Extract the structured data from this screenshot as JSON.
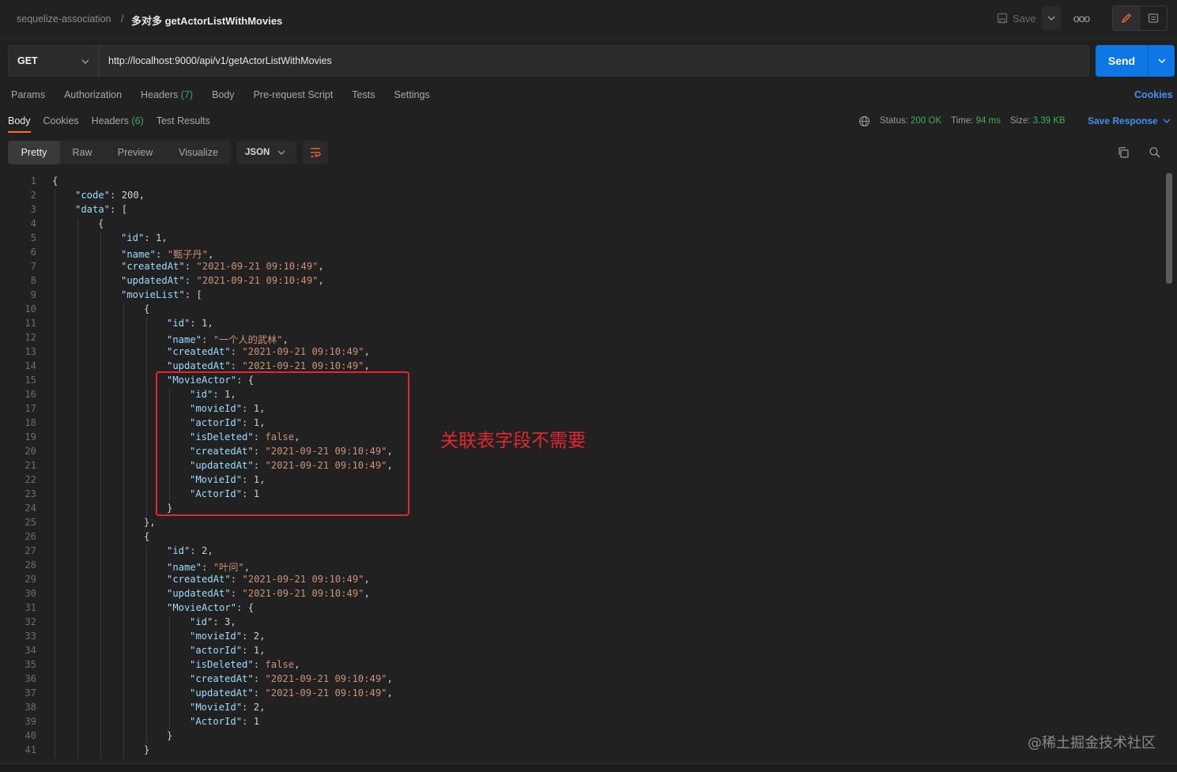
{
  "breadcrumb": {
    "parent": "sequelize-association",
    "separator": "/",
    "current": "多对多 getActorListWithMovies"
  },
  "toolbar": {
    "save_label": "Save",
    "more": "ooo"
  },
  "request": {
    "method": "GET",
    "url": "http://localhost:9000/api/v1/getActorListWithMovies",
    "send_label": "Send"
  },
  "request_tabs": {
    "params": "Params",
    "authorization": "Authorization",
    "headers": "Headers",
    "headers_count": "(7)",
    "body": "Body",
    "prerequest": "Pre-request Script",
    "tests": "Tests",
    "settings": "Settings",
    "cookies": "Cookies"
  },
  "response_tabs": {
    "body": "Body",
    "cookies": "Cookies",
    "headers": "Headers",
    "headers_count": "(6)",
    "test_results": "Test Results"
  },
  "response_meta": {
    "status_label": "Status:",
    "status_value": "200 OK",
    "time_label": "Time:",
    "time_value": "94 ms",
    "size_label": "Size:",
    "size_value": "3.39 KB",
    "save_response": "Save Response"
  },
  "view_tabs": {
    "pretty": "Pretty",
    "raw": "Raw",
    "preview": "Preview",
    "visualize": "Visualize",
    "format": "JSON"
  },
  "code_lines": [
    {
      "n": "1",
      "i": 0,
      "t": [
        [
          "b",
          "{"
        ]
      ]
    },
    {
      "n": "2",
      "i": 1,
      "t": [
        [
          "k",
          "\"code\""
        ],
        [
          "b",
          ": "
        ],
        [
          "n",
          "200"
        ],
        [
          "b",
          ","
        ]
      ]
    },
    {
      "n": "3",
      "i": 1,
      "t": [
        [
          "k",
          "\"data\""
        ],
        [
          "b",
          ": ["
        ]
      ]
    },
    {
      "n": "4",
      "i": 2,
      "t": [
        [
          "b",
          "{"
        ]
      ]
    },
    {
      "n": "5",
      "i": 3,
      "t": [
        [
          "k",
          "\"id\""
        ],
        [
          "b",
          ": "
        ],
        [
          "n",
          "1"
        ],
        [
          "b",
          ","
        ]
      ]
    },
    {
      "n": "6",
      "i": 3,
      "t": [
        [
          "k",
          "\"name\""
        ],
        [
          "b",
          ": "
        ],
        [
          "s",
          "\"甄子丹\""
        ],
        [
          "b",
          ","
        ]
      ]
    },
    {
      "n": "7",
      "i": 3,
      "t": [
        [
          "k",
          "\"createdAt\""
        ],
        [
          "b",
          ": "
        ],
        [
          "s",
          "\"2021-09-21 09:10:49\""
        ],
        [
          "b",
          ","
        ]
      ]
    },
    {
      "n": "8",
      "i": 3,
      "t": [
        [
          "k",
          "\"updatedAt\""
        ],
        [
          "b",
          ": "
        ],
        [
          "s",
          "\"2021-09-21 09:10:49\""
        ],
        [
          "b",
          ","
        ]
      ]
    },
    {
      "n": "9",
      "i": 3,
      "t": [
        [
          "k",
          "\"movieList\""
        ],
        [
          "b",
          ": ["
        ]
      ]
    },
    {
      "n": "10",
      "i": 4,
      "t": [
        [
          "b",
          "{"
        ]
      ]
    },
    {
      "n": "11",
      "i": 5,
      "t": [
        [
          "k",
          "\"id\""
        ],
        [
          "b",
          ": "
        ],
        [
          "n",
          "1"
        ],
        [
          "b",
          ","
        ]
      ]
    },
    {
      "n": "12",
      "i": 5,
      "t": [
        [
          "k",
          "\"name\""
        ],
        [
          "b",
          ": "
        ],
        [
          "s",
          "\"一个人的武林\""
        ],
        [
          "b",
          ","
        ]
      ]
    },
    {
      "n": "13",
      "i": 5,
      "t": [
        [
          "k",
          "\"createdAt\""
        ],
        [
          "b",
          ": "
        ],
        [
          "s",
          "\"2021-09-21 09:10:49\""
        ],
        [
          "b",
          ","
        ]
      ]
    },
    {
      "n": "14",
      "i": 5,
      "t": [
        [
          "k",
          "\"updatedAt\""
        ],
        [
          "b",
          ": "
        ],
        [
          "s",
          "\"2021-09-21 09:10:49\""
        ],
        [
          "b",
          ","
        ]
      ]
    },
    {
      "n": "15",
      "i": 5,
      "t": [
        [
          "k",
          "\"MovieActor\""
        ],
        [
          "b",
          ": {"
        ]
      ]
    },
    {
      "n": "16",
      "i": 6,
      "t": [
        [
          "k",
          "\"id\""
        ],
        [
          "b",
          ": "
        ],
        [
          "n",
          "1"
        ],
        [
          "b",
          ","
        ]
      ]
    },
    {
      "n": "17",
      "i": 6,
      "t": [
        [
          "k",
          "\"movieId\""
        ],
        [
          "b",
          ": "
        ],
        [
          "n",
          "1"
        ],
        [
          "b",
          ","
        ]
      ]
    },
    {
      "n": "18",
      "i": 6,
      "t": [
        [
          "k",
          "\"actorId\""
        ],
        [
          "b",
          ": "
        ],
        [
          "n",
          "1"
        ],
        [
          "b",
          ","
        ]
      ]
    },
    {
      "n": "19",
      "i": 6,
      "t": [
        [
          "k",
          "\"isDeleted\""
        ],
        [
          "b",
          ": "
        ],
        [
          "s",
          "false"
        ],
        [
          "b",
          ","
        ]
      ]
    },
    {
      "n": "20",
      "i": 6,
      "t": [
        [
          "k",
          "\"createdAt\""
        ],
        [
          "b",
          ": "
        ],
        [
          "s",
          "\"2021-09-21 09:10:49\""
        ],
        [
          "b",
          ","
        ]
      ]
    },
    {
      "n": "21",
      "i": 6,
      "t": [
        [
          "k",
          "\"updatedAt\""
        ],
        [
          "b",
          ": "
        ],
        [
          "s",
          "\"2021-09-21 09:10:49\""
        ],
        [
          "b",
          ","
        ]
      ]
    },
    {
      "n": "22",
      "i": 6,
      "t": [
        [
          "k",
          "\"MovieId\""
        ],
        [
          "b",
          ": "
        ],
        [
          "n",
          "1"
        ],
        [
          "b",
          ","
        ]
      ]
    },
    {
      "n": "23",
      "i": 6,
      "t": [
        [
          "k",
          "\"ActorId\""
        ],
        [
          "b",
          ": "
        ],
        [
          "n",
          "1"
        ]
      ]
    },
    {
      "n": "24",
      "i": 5,
      "t": [
        [
          "b",
          "}"
        ]
      ]
    },
    {
      "n": "25",
      "i": 4,
      "t": [
        [
          "b",
          "},"
        ]
      ]
    },
    {
      "n": "26",
      "i": 4,
      "t": [
        [
          "b",
          "{"
        ]
      ]
    },
    {
      "n": "27",
      "i": 5,
      "t": [
        [
          "k",
          "\"id\""
        ],
        [
          "b",
          ": "
        ],
        [
          "n",
          "2"
        ],
        [
          "b",
          ","
        ]
      ]
    },
    {
      "n": "28",
      "i": 5,
      "t": [
        [
          "k",
          "\"name\""
        ],
        [
          "b",
          ": "
        ],
        [
          "s",
          "\"叶问\""
        ],
        [
          "b",
          ","
        ]
      ]
    },
    {
      "n": "29",
      "i": 5,
      "t": [
        [
          "k",
          "\"createdAt\""
        ],
        [
          "b",
          ": "
        ],
        [
          "s",
          "\"2021-09-21 09:10:49\""
        ],
        [
          "b",
          ","
        ]
      ]
    },
    {
      "n": "30",
      "i": 5,
      "t": [
        [
          "k",
          "\"updatedAt\""
        ],
        [
          "b",
          ": "
        ],
        [
          "s",
          "\"2021-09-21 09:10:49\""
        ],
        [
          "b",
          ","
        ]
      ]
    },
    {
      "n": "31",
      "i": 5,
      "t": [
        [
          "k",
          "\"MovieActor\""
        ],
        [
          "b",
          ": {"
        ]
      ]
    },
    {
      "n": "32",
      "i": 6,
      "t": [
        [
          "k",
          "\"id\""
        ],
        [
          "b",
          ": "
        ],
        [
          "n",
          "3"
        ],
        [
          "b",
          ","
        ]
      ]
    },
    {
      "n": "33",
      "i": 6,
      "t": [
        [
          "k",
          "\"movieId\""
        ],
        [
          "b",
          ": "
        ],
        [
          "n",
          "2"
        ],
        [
          "b",
          ","
        ]
      ]
    },
    {
      "n": "34",
      "i": 6,
      "t": [
        [
          "k",
          "\"actorId\""
        ],
        [
          "b",
          ": "
        ],
        [
          "n",
          "1"
        ],
        [
          "b",
          ","
        ]
      ]
    },
    {
      "n": "35",
      "i": 6,
      "t": [
        [
          "k",
          "\"isDeleted\""
        ],
        [
          "b",
          ": "
        ],
        [
          "s",
          "false"
        ],
        [
          "b",
          ","
        ]
      ]
    },
    {
      "n": "36",
      "i": 6,
      "t": [
        [
          "k",
          "\"createdAt\""
        ],
        [
          "b",
          ": "
        ],
        [
          "s",
          "\"2021-09-21 09:10:49\""
        ],
        [
          "b",
          ","
        ]
      ]
    },
    {
      "n": "37",
      "i": 6,
      "t": [
        [
          "k",
          "\"updatedAt\""
        ],
        [
          "b",
          ": "
        ],
        [
          "s",
          "\"2021-09-21 09:10:49\""
        ],
        [
          "b",
          ","
        ]
      ]
    },
    {
      "n": "38",
      "i": 6,
      "t": [
        [
          "k",
          "\"MovieId\""
        ],
        [
          "b",
          ": "
        ],
        [
          "n",
          "2"
        ],
        [
          "b",
          ","
        ]
      ]
    },
    {
      "n": "39",
      "i": 6,
      "t": [
        [
          "k",
          "\"ActorId\""
        ],
        [
          "b",
          ": "
        ],
        [
          "n",
          "1"
        ]
      ]
    },
    {
      "n": "40",
      "i": 5,
      "t": [
        [
          "b",
          "}"
        ]
      ]
    },
    {
      "n": "41",
      "i": 4,
      "t": [
        [
          "b",
          "}"
        ]
      ]
    }
  ],
  "annotation": "关联表字段不需要",
  "watermark": "@稀土掘金技术社区",
  "colors": {
    "accent": "#0d77e6",
    "link": "#3c94f0",
    "ok": "#3fae5b",
    "highlight": "#e5262e"
  }
}
